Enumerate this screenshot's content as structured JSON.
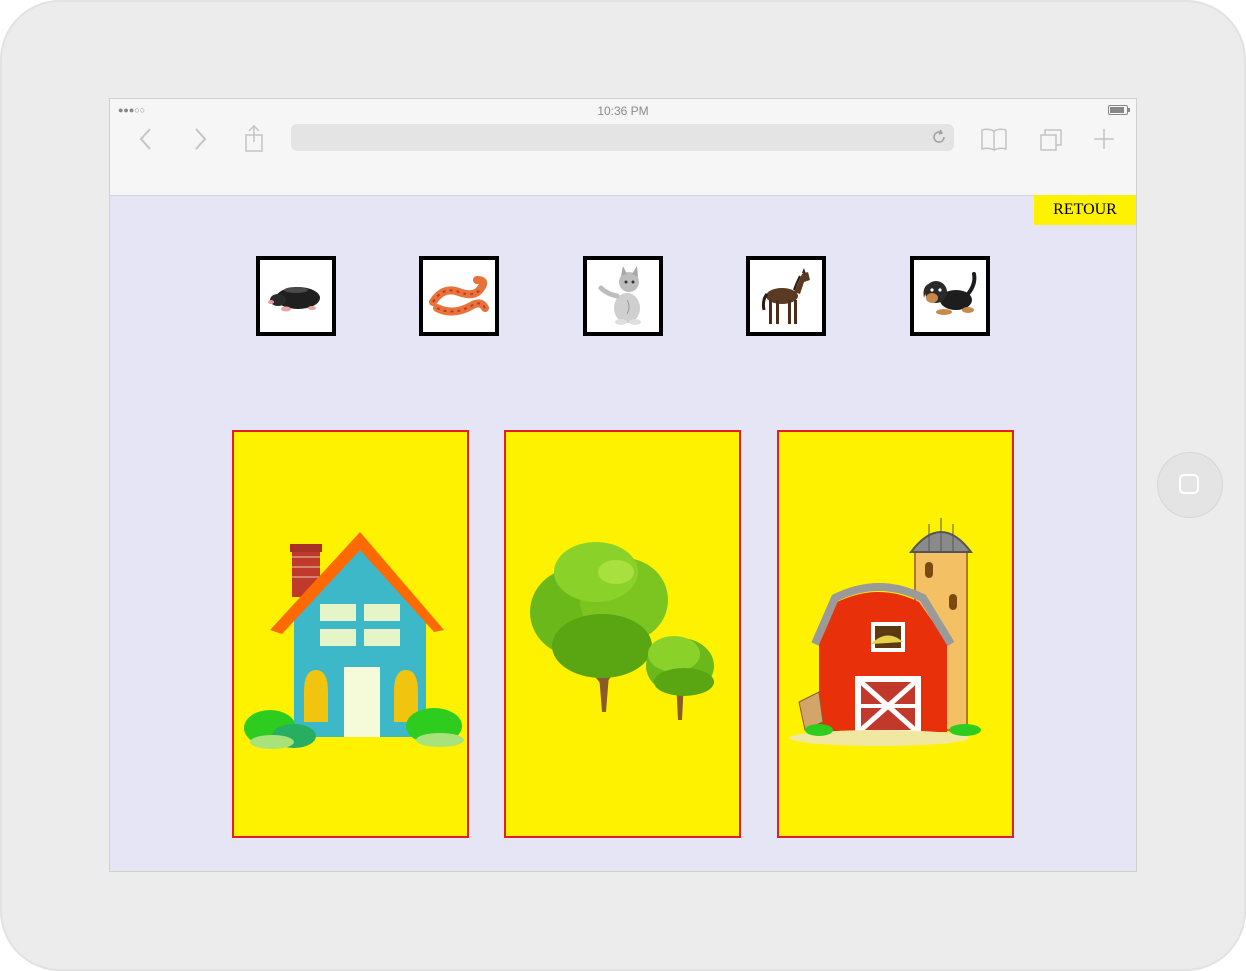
{
  "status_bar": {
    "signal": "●●●○○",
    "time": "10:36 PM"
  },
  "browser": {
    "icons": [
      "back-icon",
      "forward-icon",
      "share-icon",
      "reload-icon",
      "bookmarks-icon",
      "tabs-icon",
      "new-tab-icon"
    ]
  },
  "page": {
    "retour_label": "RETOUR",
    "animals": [
      {
        "name": "mole",
        "icon": "mole-icon"
      },
      {
        "name": "snake",
        "icon": "snake-icon"
      },
      {
        "name": "cat",
        "icon": "cat-icon"
      },
      {
        "name": "horse",
        "icon": "horse-icon"
      },
      {
        "name": "dog",
        "icon": "dog-icon"
      }
    ],
    "habitats": [
      {
        "name": "house",
        "icon": "house-icon"
      },
      {
        "name": "trees",
        "icon": "tree-icon"
      },
      {
        "name": "farm",
        "icon": "barn-icon"
      }
    ]
  },
  "colors": {
    "page_background": "#e5e5f6",
    "habitat_background": "#fff200",
    "habitat_border": "#e02020",
    "retour_background": "#fff200"
  }
}
